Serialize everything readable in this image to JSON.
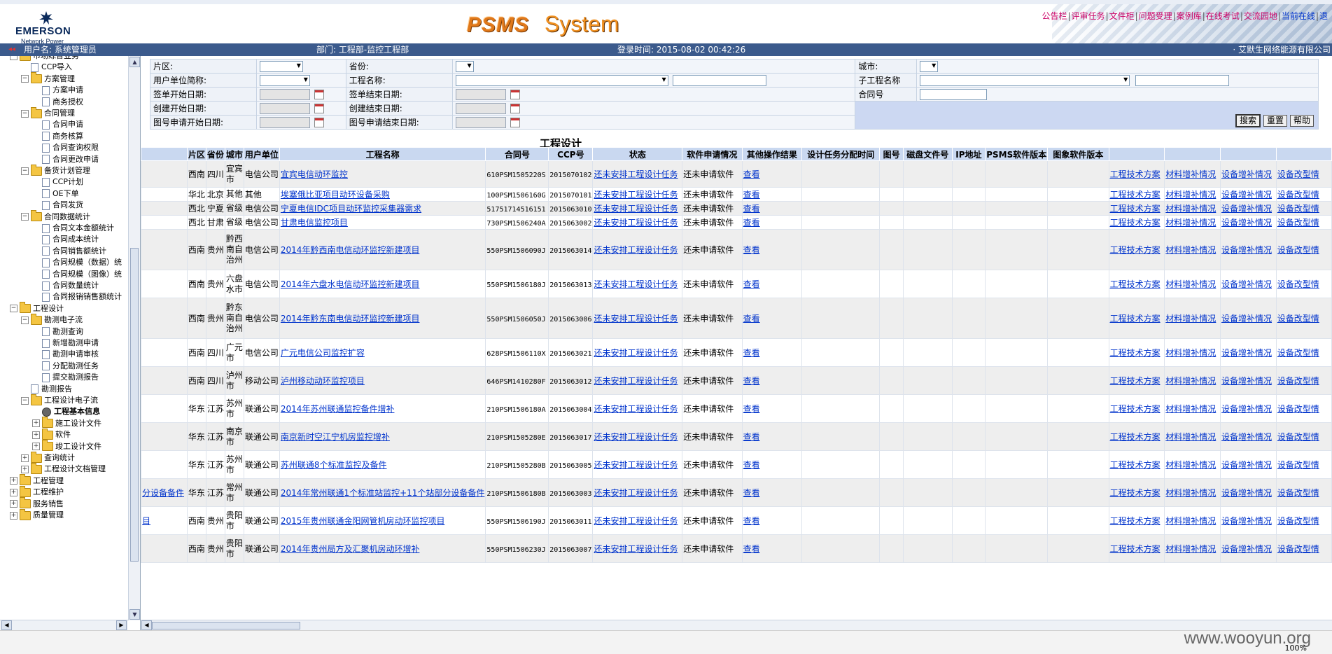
{
  "header": {
    "logo_name": "EMERSON",
    "logo_sub": "Network Power",
    "brand_left": "PSMS",
    "brand_right": "System",
    "links": [
      "公告栏",
      "评审任务",
      "文件柜",
      "问题受理",
      "案例库",
      "在线考试",
      "交流园地",
      "当前在线",
      "退"
    ]
  },
  "userbar": {
    "user": "用户名: 系统管理员",
    "dept": "部门: 工程部-监控工程部",
    "login": "登录时间: 2015-08-02 00:42:26",
    "company": "· 艾默生网络能源有限公司"
  },
  "sidebar": {
    "nodes": [
      {
        "label": "市场综合业务",
        "type": "folder",
        "level": 1,
        "exp": "-"
      },
      {
        "label": "CCP导入",
        "type": "doc",
        "level": 2
      },
      {
        "label": "方案管理",
        "type": "folder",
        "level": 2,
        "exp": "-"
      },
      {
        "label": "方案申请",
        "type": "doc",
        "level": 3
      },
      {
        "label": "商务授权",
        "type": "doc",
        "level": 3
      },
      {
        "label": "合同管理",
        "type": "folder",
        "level": 2,
        "exp": "-"
      },
      {
        "label": "合同申请",
        "type": "doc",
        "level": 3
      },
      {
        "label": "商务核算",
        "type": "doc",
        "level": 3
      },
      {
        "label": "合同查询权限",
        "type": "doc",
        "level": 3
      },
      {
        "label": "合同更改申请",
        "type": "doc",
        "level": 3
      },
      {
        "label": "备货计划管理",
        "type": "folder",
        "level": 2,
        "exp": "-"
      },
      {
        "label": "CCP计划",
        "type": "doc",
        "level": 3
      },
      {
        "label": "OE下单",
        "type": "doc",
        "level": 3
      },
      {
        "label": "合同发货",
        "type": "doc",
        "level": 3
      },
      {
        "label": "合同数据统计",
        "type": "folder",
        "level": 2,
        "exp": "-"
      },
      {
        "label": "合同文本金额统计",
        "type": "doc",
        "level": 3
      },
      {
        "label": "合同成本统计",
        "type": "doc",
        "level": 3
      },
      {
        "label": "合同销售额统计",
        "type": "doc",
        "level": 3
      },
      {
        "label": "合同规模（数据）统",
        "type": "doc",
        "level": 3
      },
      {
        "label": "合同规模（图像）统",
        "type": "doc",
        "level": 3
      },
      {
        "label": "合同数量统计",
        "type": "doc",
        "level": 3
      },
      {
        "label": "合同报销销售额统计",
        "type": "doc",
        "level": 3
      },
      {
        "label": "工程设计",
        "type": "folder",
        "level": 1,
        "exp": "-"
      },
      {
        "label": "勘测电子流",
        "type": "folder",
        "level": 2,
        "exp": "-"
      },
      {
        "label": "勘测查询",
        "type": "doc",
        "level": 3
      },
      {
        "label": "新增勘测申请",
        "type": "doc",
        "level": 3
      },
      {
        "label": "勘测申请审核",
        "type": "doc",
        "level": 3
      },
      {
        "label": "分配勘测任务",
        "type": "doc",
        "level": 3
      },
      {
        "label": "提交勘测报告",
        "type": "doc",
        "level": 3
      },
      {
        "label": "勘测报告",
        "type": "doc",
        "level": 2
      },
      {
        "label": "工程设计电子流",
        "type": "folder",
        "level": 2,
        "exp": "-"
      },
      {
        "label": "工程基本信息",
        "type": "gear",
        "level": 3,
        "bold": true
      },
      {
        "label": "施工设计文件",
        "type": "folder",
        "level": 3,
        "exp": "+"
      },
      {
        "label": "软件",
        "type": "folder",
        "level": 3,
        "exp": "+"
      },
      {
        "label": "竣工设计文件",
        "type": "folder",
        "level": 3,
        "exp": "+"
      },
      {
        "label": "查询统计",
        "type": "folder",
        "level": 2,
        "exp": "+"
      },
      {
        "label": "工程设计文档管理",
        "type": "folder",
        "level": 2,
        "exp": "+"
      },
      {
        "label": "工程管理",
        "type": "folder",
        "level": 1,
        "exp": "+"
      },
      {
        "label": "工程维护",
        "type": "folder",
        "level": 1,
        "exp": "+"
      },
      {
        "label": "服务销售",
        "type": "folder",
        "level": 1,
        "exp": "+"
      },
      {
        "label": "质量管理",
        "type": "folder",
        "level": 1,
        "exp": "+"
      }
    ]
  },
  "filters": {
    "region": "片区:",
    "province": "省份:",
    "city": "城市:",
    "user_unit": "用户单位简称:",
    "project_name": "工程名称:",
    "sub_project": "子工程名称",
    "sign_start": "签单开始日期:",
    "sign_end": "签单结束日期:",
    "contract_no": "合同号",
    "create_start": "创建开始日期:",
    "create_end": "创建结束日期:",
    "draw_start": "图号申请开始日期:",
    "draw_end": "图号申请结束日期:",
    "search_btn": "搜索",
    "reset_btn": "重置",
    "help_btn": "帮助"
  },
  "grid": {
    "title": "工程设计",
    "columns": [
      "",
      "片区",
      "省份",
      "城市",
      "用户单位",
      "工程名称",
      "合同号",
      "CCP号",
      "状态",
      "软件申请情况",
      "其他操作结果",
      "设计任务分配时间",
      "图号",
      "磁盘文件号",
      "IP地址",
      "PSMS软件版本",
      "图象软件版本",
      "",
      "",
      "",
      ""
    ],
    "rows": [
      {
        "pre": "",
        "region": "西南",
        "prov": "四川",
        "city": "宜宾市",
        "unit": "电信公司",
        "name": "宜宾电信动环监控",
        "contract": "610PSM1505220S",
        "ccp": "2015070102",
        "status": "还未安排工程设计任务",
        "soft": "还未申请软件",
        "op": "查看",
        "a1": "工程技术方案",
        "a2": "材料增补情况",
        "a3": "设备增补情况",
        "a4": "设备改型情"
      },
      {
        "pre": "",
        "region": "华北",
        "prov": "北京",
        "city": "其他",
        "unit": "其他",
        "name": "埃塞俄比亚项目动环设备采购",
        "contract": "100PSM1506160G",
        "ccp": "2015070101",
        "status": "还未安排工程设计任务",
        "soft": "还未申请软件",
        "op": "查看",
        "a1": "工程技术方案",
        "a2": "材料增补情况",
        "a3": "设备增补情况",
        "a4": "设备改型情"
      },
      {
        "pre": "",
        "region": "西北",
        "prov": "宁夏",
        "city": "省级",
        "unit": "电信公司",
        "name": "宁夏电信IDC项目动环监控采集器需求",
        "contract": "51751714516151",
        "ccp": "2015063010",
        "status": "还未安排工程设计任务",
        "soft": "还未申请软件",
        "op": "查看",
        "a1": "工程技术方案",
        "a2": "材料增补情况",
        "a3": "设备增补情况",
        "a4": "设备改型情"
      },
      {
        "pre": "",
        "region": "西北",
        "prov": "甘肃",
        "city": "省级",
        "unit": "电信公司",
        "name": "甘肃电信监控项目",
        "contract": "730PSM1506240A",
        "ccp": "2015063002",
        "status": "还未安排工程设计任务",
        "soft": "还未申请软件",
        "op": "查看",
        "a1": "工程技术方案",
        "a2": "材料增补情况",
        "a3": "设备增补情况",
        "a4": "设备改型情"
      },
      {
        "pre": "",
        "region": "西南",
        "prov": "贵州",
        "city": "黔西南自治州",
        "unit": "电信公司",
        "name": "2014年黔西南电信动环监控新建项目",
        "contract": "550PSM1506090J",
        "ccp": "2015063014",
        "status": "还未安排工程设计任务",
        "soft": "还未申请软件",
        "op": "查看",
        "a1": "工程技术方案",
        "a2": "材料增补情况",
        "a3": "设备增补情况",
        "a4": "设备改型情"
      },
      {
        "pre": "",
        "region": "西南",
        "prov": "贵州",
        "city": "六盘水市",
        "unit": "电信公司",
        "name": "2014年六盘水电信动环监控新建项目",
        "contract": "550PSM1506180J",
        "ccp": "2015063013",
        "status": "还未安排工程设计任务",
        "soft": "还未申请软件",
        "op": "查看",
        "a1": "工程技术方案",
        "a2": "材料增补情况",
        "a3": "设备增补情况",
        "a4": "设备改型情"
      },
      {
        "pre": "",
        "region": "西南",
        "prov": "贵州",
        "city": "黔东南自治州",
        "unit": "电信公司",
        "name": "2014年黔东南电信动环监控新建项目",
        "contract": "550PSM1506050J",
        "ccp": "2015063006",
        "status": "还未安排工程设计任务",
        "soft": "还未申请软件",
        "op": "查看",
        "a1": "工程技术方案",
        "a2": "材料增补情况",
        "a3": "设备增补情况",
        "a4": "设备改型情"
      },
      {
        "pre": "",
        "region": "西南",
        "prov": "四川",
        "city": "广元市",
        "unit": "电信公司",
        "name": "广元电信公司监控扩容",
        "contract": "628PSM1506110X",
        "ccp": "2015063021",
        "status": "还未安排工程设计任务",
        "soft": "还未申请软件",
        "op": "查看",
        "a1": "工程技术方案",
        "a2": "材料增补情况",
        "a3": "设备增补情况",
        "a4": "设备改型情"
      },
      {
        "pre": "",
        "region": "西南",
        "prov": "四川",
        "city": "泸州市",
        "unit": "移动公司",
        "name": "泸州移动动环监控项目",
        "contract": "646PSM1410280F",
        "ccp": "2015063012",
        "status": "还未安排工程设计任务",
        "soft": "还未申请软件",
        "op": "查看",
        "a1": "工程技术方案",
        "a2": "材料增补情况",
        "a3": "设备增补情况",
        "a4": "设备改型情"
      },
      {
        "pre": "",
        "region": "华东",
        "prov": "江苏",
        "city": "苏州市",
        "unit": "联通公司",
        "name": "2014年苏州联通监控备件增补",
        "contract": "210PSM1506180A",
        "ccp": "2015063004",
        "status": "还未安排工程设计任务",
        "soft": "还未申请软件",
        "op": "查看",
        "a1": "工程技术方案",
        "a2": "材料增补情况",
        "a3": "设备增补情况",
        "a4": "设备改型情"
      },
      {
        "pre": "",
        "region": "华东",
        "prov": "江苏",
        "city": "南京市",
        "unit": "联通公司",
        "name": "南京新时空江宁机房监控增补",
        "contract": "210PSM1505280E",
        "ccp": "2015063017",
        "status": "还未安排工程设计任务",
        "soft": "还未申请软件",
        "op": "查看",
        "a1": "工程技术方案",
        "a2": "材料增补情况",
        "a3": "设备增补情况",
        "a4": "设备改型情"
      },
      {
        "pre": "",
        "region": "华东",
        "prov": "江苏",
        "city": "苏州市",
        "unit": "联通公司",
        "name": "苏州联通8个标准监控及备件",
        "contract": "210PSM1505280B",
        "ccp": "2015063005",
        "status": "还未安排工程设计任务",
        "soft": "还未申请软件",
        "op": "查看",
        "a1": "工程技术方案",
        "a2": "材料增补情况",
        "a3": "设备增补情况",
        "a4": "设备改型情"
      },
      {
        "pre": "分设备备件",
        "region": "华东",
        "prov": "江苏",
        "city": "常州市",
        "unit": "联通公司",
        "name": "2014年常州联通1个标准站监控+11个站部分设备备件",
        "contract": "210PSM1506180B",
        "ccp": "2015063003",
        "status": "还未安排工程设计任务",
        "soft": "还未申请软件",
        "op": "查看",
        "a1": "工程技术方案",
        "a2": "材料增补情况",
        "a3": "设备增补情况",
        "a4": "设备改型情"
      },
      {
        "pre": "目",
        "region": "西南",
        "prov": "贵州",
        "city": "贵阳市",
        "unit": "联通公司",
        "name": "2015年贵州联通金阳网管机房动环监控项目",
        "contract": "550PSM1506190J",
        "ccp": "2015063011",
        "status": "还未安排工程设计任务",
        "soft": "还未申请软件",
        "op": "查看",
        "a1": "工程技术方案",
        "a2": "材料增补情况",
        "a3": "设备增补情况",
        "a4": "设备改型情"
      },
      {
        "pre": "",
        "region": "西南",
        "prov": "贵州",
        "city": "贵阳市",
        "unit": "联通公司",
        "name": "2014年贵州局方及汇聚机房动环增补",
        "contract": "550PSM1506230J",
        "ccp": "2015063007",
        "status": "还未安排工程设计任务",
        "soft": "还未申请软件",
        "op": "查看",
        "a1": "工程技术方案",
        "a2": "材料增补情况",
        "a3": "设备增补情况",
        "a4": "设备改型情"
      }
    ]
  },
  "status": {
    "zoom": "100%",
    "watermark": "www.wooyun.org"
  }
}
